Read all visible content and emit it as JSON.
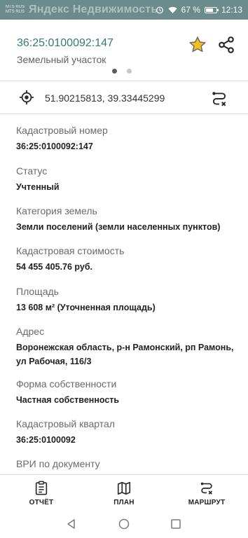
{
  "status_bar": {
    "carrier_line1": "MTS RUS",
    "carrier_line2": "MTS RUS",
    "app_title": "Яндекс Недвижимость",
    "battery": "67 %",
    "time": "12:13"
  },
  "header": {
    "cadastral_number": "36:25:0100092:147",
    "object_type": "Земельный участок",
    "page_indicator": {
      "total": 2,
      "active_index": 0
    }
  },
  "coordinates": {
    "text": "51.90215813, 39.33445299"
  },
  "fields": [
    {
      "label": "Кадастровый номер",
      "value": "36:25:0100092:147"
    },
    {
      "label": "Статус",
      "value": "Учтенный"
    },
    {
      "label": "Категория земель",
      "value": "Земли поселений (земли населенных пунктов)"
    },
    {
      "label": "Кадастровая стоимость",
      "value": "54 455 405.76 руб."
    },
    {
      "label": "Площадь",
      "value": "13 608 м² (Уточненная площадь)"
    },
    {
      "label": "Адрес",
      "value": "Воронежская область, р-н Рамонский, рп Рамонь,",
      "value_line2": "ул Рабочая, 116/3"
    },
    {
      "label": "Форма собственности",
      "value": "Частная собственность"
    },
    {
      "label": "Кадастровый квартал",
      "value": "36:25:0100092"
    },
    {
      "label": "ВРИ по документу"
    }
  ],
  "bottom_nav": {
    "report": "ОТЧЁТ",
    "plan": "ПЛАН",
    "route": "МАРШРУТ"
  },
  "colors": {
    "accent_green": "#2f7f70",
    "star_yellow": "#f2c21b",
    "status_bar": "#6b8b8c"
  },
  "icons": [
    "star-icon",
    "share-icon",
    "location-target-icon",
    "route-icon",
    "report-icon",
    "map-icon"
  ]
}
